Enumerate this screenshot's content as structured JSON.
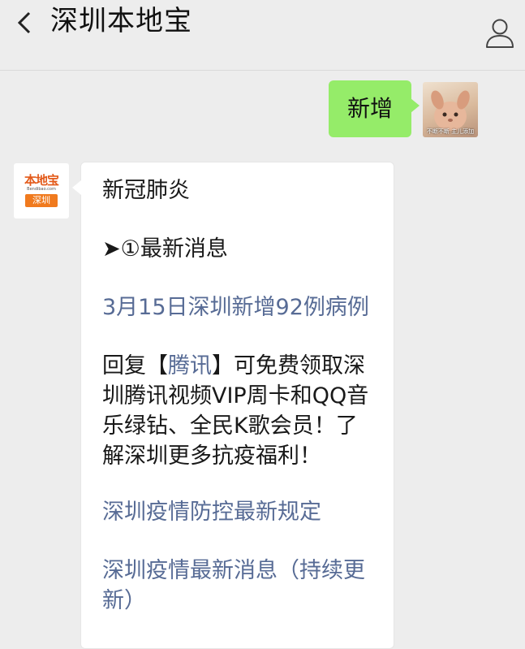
{
  "header": {
    "title": "深圳本地宝",
    "back_icon": "chevron-left-icon",
    "profile_icon": "person-icon"
  },
  "outgoing": {
    "text": "新增",
    "avatar_caption": "不断不断 主儿添加",
    "bubble_color": "#95ec69"
  },
  "incoming": {
    "avatar_logo_top": "本地宝",
    "avatar_logo_mid": "Bendibao.com",
    "avatar_logo_box": "深圳",
    "heading": "新冠肺炎",
    "section": "➤①最新消息",
    "link1": "3月15日深圳新增92例病例",
    "reply_prefix": "回复【",
    "reply_keyword": "腾讯",
    "reply_suffix_line1": "】可免费领取深",
    "reply_line2": "圳腾讯视频VIP周卡和QQ音",
    "reply_line3": "乐绿钻、全民K歌会员！了",
    "reply_line4": "解深圳更多抗疫福利！",
    "link2": "深圳疫情防控最新规定",
    "link3_line1": "深圳疫情最新消息（持续更",
    "link3_line2": "新）",
    "link_color": "#576b95"
  }
}
